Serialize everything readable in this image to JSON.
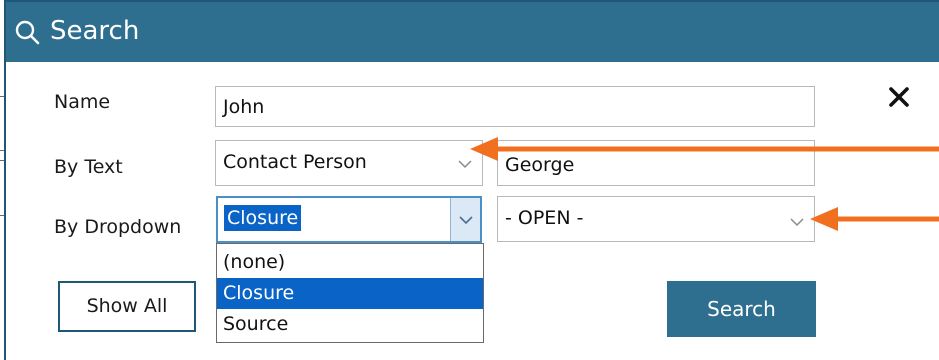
{
  "window": {
    "title": "Search",
    "title_icon": "search-icon",
    "close_icon": "close-icon"
  },
  "form": {
    "name_label": "Name",
    "name_value": "John",
    "by_text_label": "By Text",
    "by_text_field_selected": "Contact Person",
    "by_text_value": "George",
    "by_dropdown_label": "By Dropdown",
    "by_dropdown_field_selected": "Closure",
    "by_dropdown_value_selected": "- OPEN -",
    "dropdown_options": [
      "(none)",
      "Closure",
      "Source"
    ]
  },
  "buttons": {
    "show_all": "Show All",
    "search": "Search"
  },
  "colors": {
    "title_bar": "#2e6e8e",
    "selection": "#0a64c8",
    "annotation_arrow": "#f07020"
  }
}
